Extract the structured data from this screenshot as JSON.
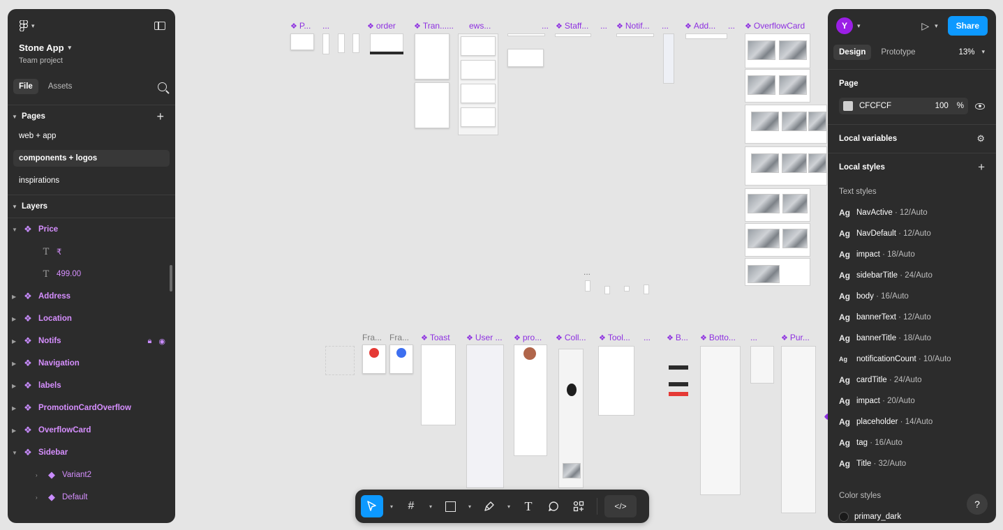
{
  "canvas": {
    "frame_labels": [
      "P...",
      "...",
      "order",
      "Tran...",
      "...",
      "ews...",
      "...",
      "Staff...",
      "...",
      "Notif...",
      "...",
      "Add...",
      "...",
      "OverflowCard"
    ],
    "bottom_labels": [
      "Fra...",
      "Fra...",
      "Toast",
      "User ...",
      "pro...",
      "Coll...",
      "Tool...",
      "...",
      "B...",
      "Botto...",
      "...",
      "Pur..."
    ],
    "dots_label": "..."
  },
  "left_panel": {
    "project_name": "Stone App",
    "project_sub": "Team project",
    "tabs": [
      "File",
      "Assets"
    ],
    "pages_title": "Pages",
    "pages": [
      "web + app",
      "components + logos",
      "inspirations"
    ],
    "layers_title": "Layers",
    "layers": [
      {
        "name": "Price"
      },
      {
        "name": "₹"
      },
      {
        "name": "499.00"
      },
      {
        "name": "Address"
      },
      {
        "name": "Location"
      },
      {
        "name": "Notifs"
      },
      {
        "name": "Navigation"
      },
      {
        "name": "labels"
      },
      {
        "name": "PromotionCardOverflow"
      },
      {
        "name": "OverflowCard"
      },
      {
        "name": "Sidebar"
      },
      {
        "name": "Variant2"
      },
      {
        "name": "Default"
      }
    ]
  },
  "right_panel": {
    "avatar_letter": "Y",
    "share_label": "Share",
    "tabs": [
      "Design",
      "Prototype"
    ],
    "zoom": "13%",
    "page_title": "Page",
    "page_color": "CFCFCF",
    "page_opacity": "100",
    "percent": "%",
    "local_variables": "Local variables",
    "local_styles": "Local styles",
    "text_styles_title": "Text styles",
    "text_styles": [
      {
        "name": "NavActive",
        "meta": " · 12/Auto"
      },
      {
        "name": "NavDefault",
        "meta": " · 12/Auto"
      },
      {
        "name": "impact",
        "meta": " · 18/Auto"
      },
      {
        "name": "sidebarTitle",
        "meta": " · 24/Auto"
      },
      {
        "name": "body",
        "meta": " · 16/Auto"
      },
      {
        "name": "bannerText",
        "meta": " · 12/Auto"
      },
      {
        "name": "bannerTitle",
        "meta": " · 18/Auto"
      },
      {
        "name": "notificationCount",
        "meta": " · 10/Auto"
      },
      {
        "name": "cardTitle",
        "meta": " · 24/Auto"
      },
      {
        "name": "impact",
        "meta": " · 20/Auto"
      },
      {
        "name": "placeholder",
        "meta": " · 14/Auto"
      },
      {
        "name": "tag",
        "meta": " · 16/Auto"
      },
      {
        "name": "Title",
        "meta": " · 32/Auto"
      }
    ],
    "ag": "Ag",
    "color_styles_title": "Color styles",
    "color_styles": [
      "primary_dark"
    ],
    "help": "?"
  },
  "toolbar": {
    "text_tool": "T",
    "dev_mode": "</>"
  }
}
